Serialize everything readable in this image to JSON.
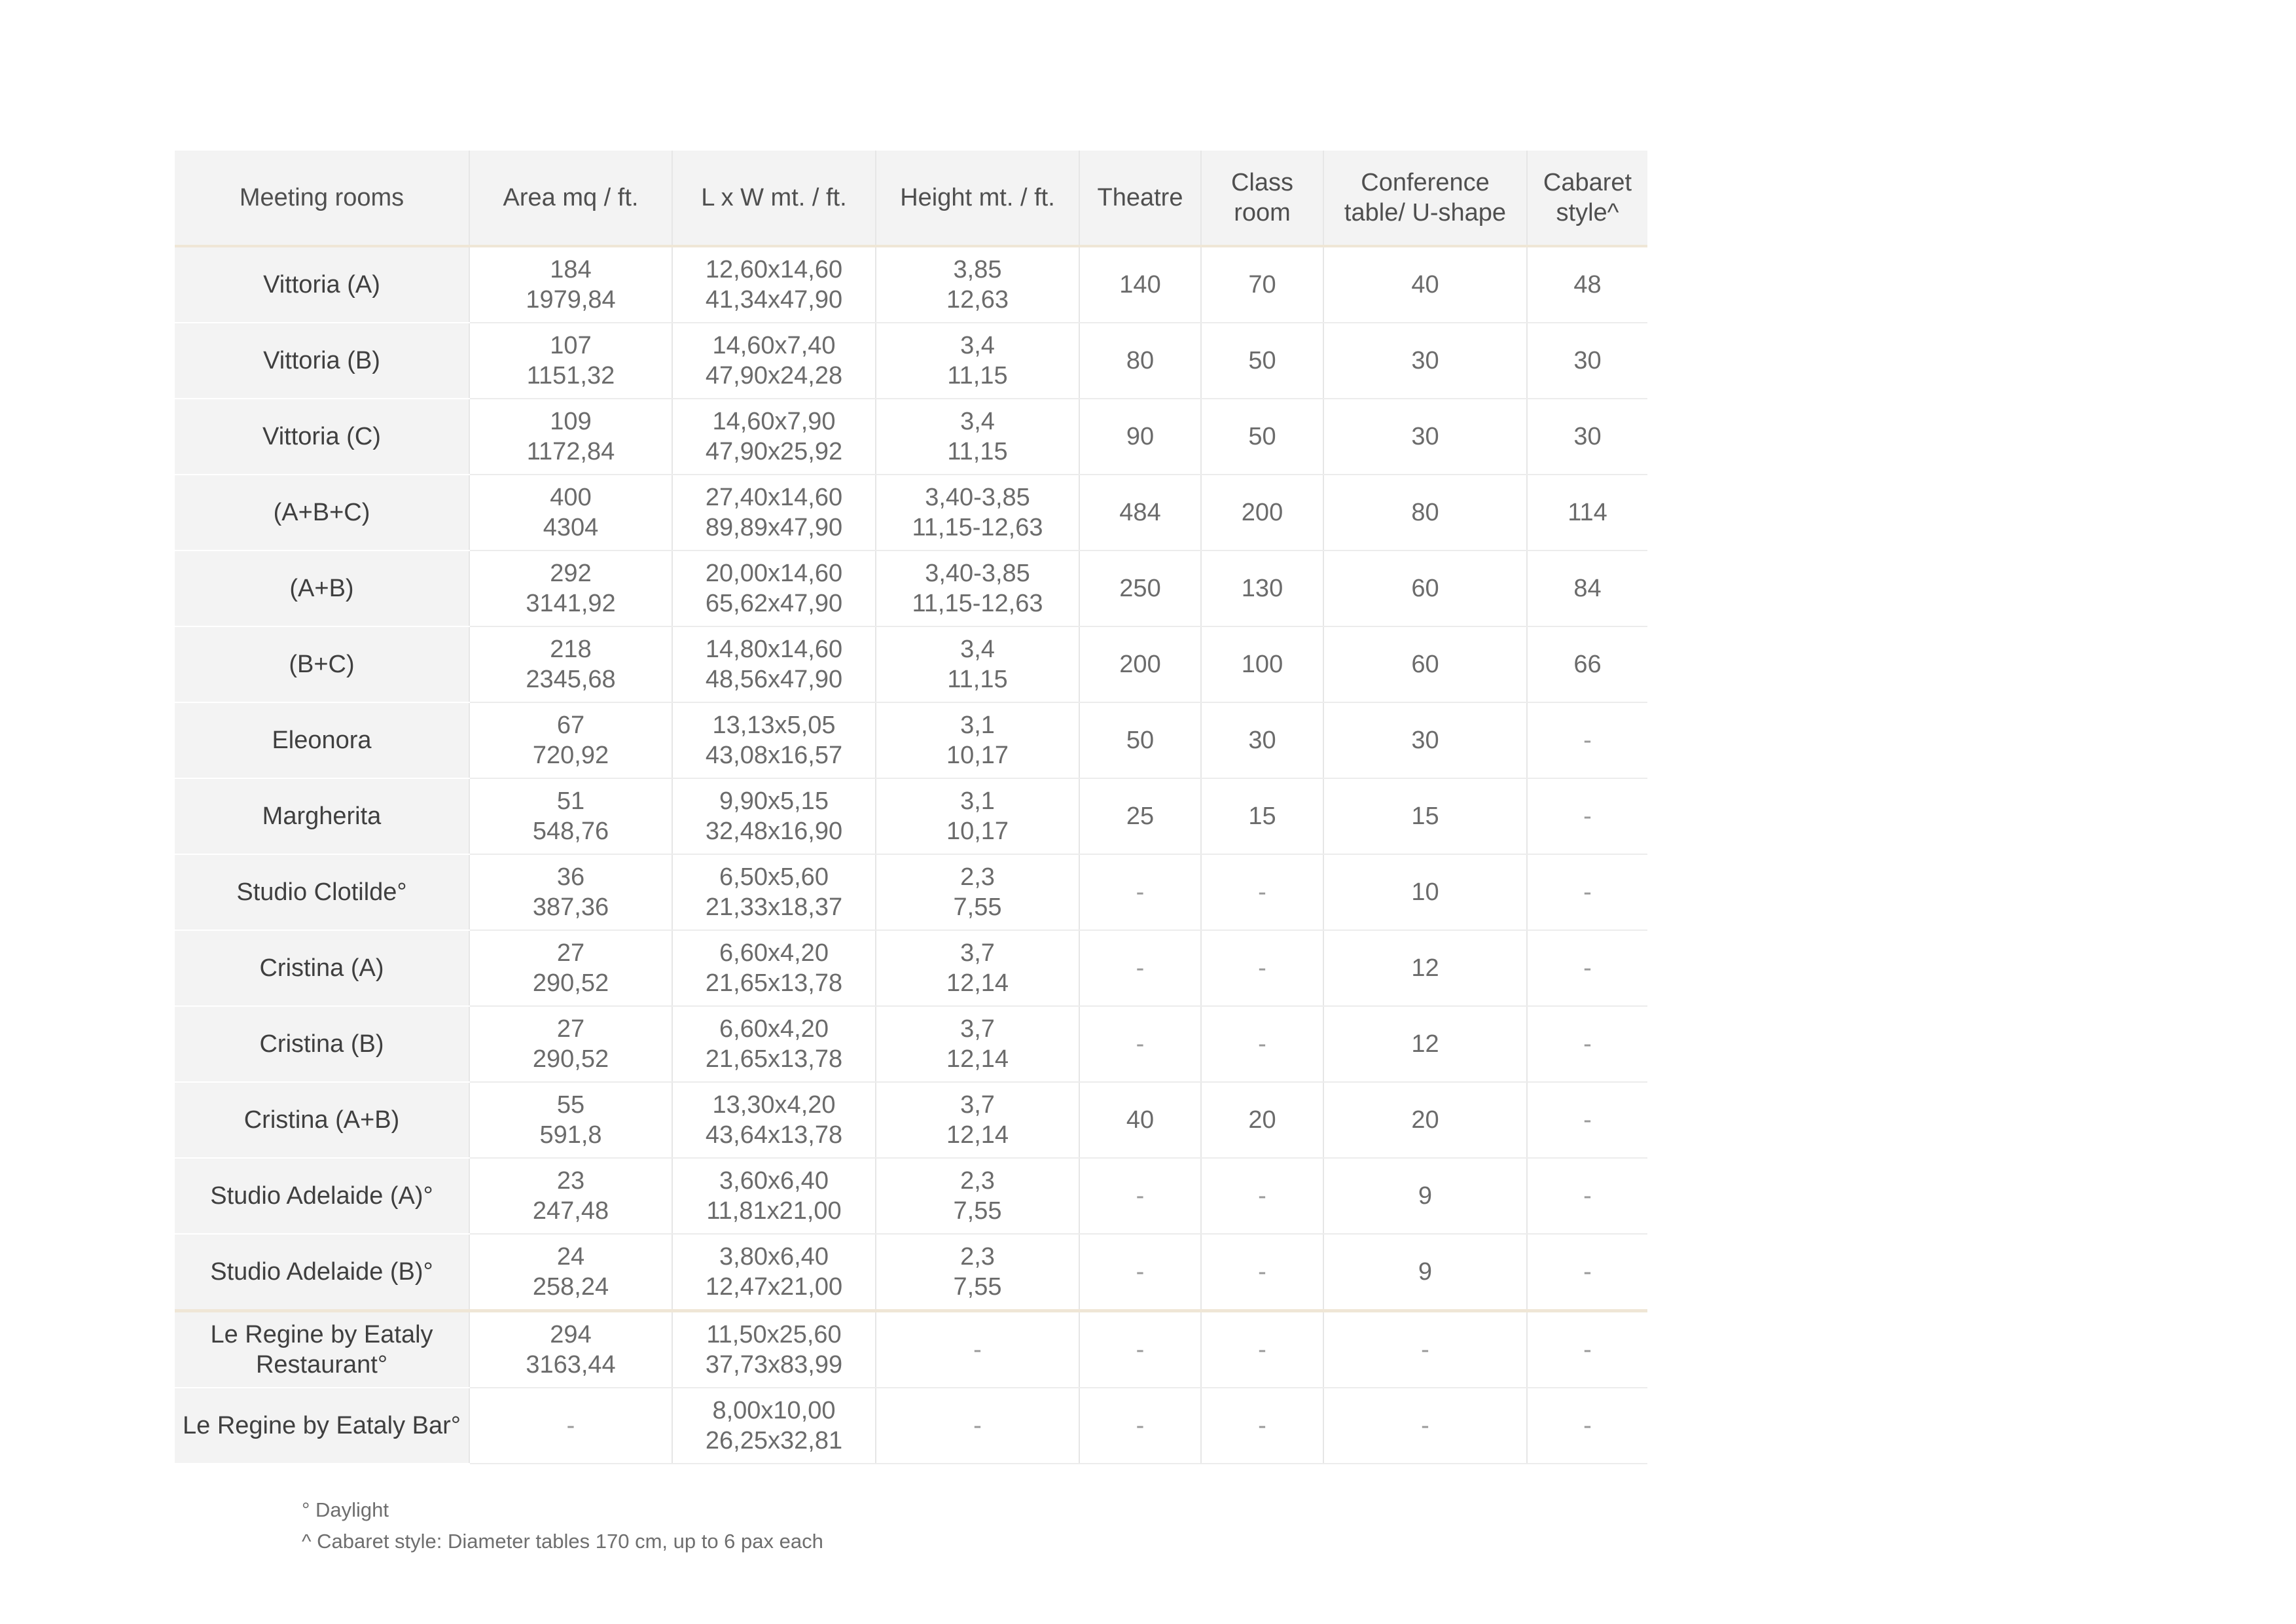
{
  "table": {
    "headers": [
      {
        "lines": [
          "Meeting rooms"
        ]
      },
      {
        "lines": [
          "Area mq / ft."
        ]
      },
      {
        "lines": [
          "L x W mt. / ft."
        ]
      },
      {
        "lines": [
          "Height mt. / ft."
        ]
      },
      {
        "lines": [
          "Theatre"
        ]
      },
      {
        "lines": [
          "Class",
          "room"
        ]
      },
      {
        "lines": [
          "Conference",
          "table/ U-shape"
        ]
      },
      {
        "lines": [
          "Cabaret",
          "style^"
        ]
      }
    ],
    "rows": [
      {
        "name": [
          "Vittoria (A)"
        ],
        "area": [
          "184",
          "1979,84"
        ],
        "lw": [
          "12,60x14,60",
          "41,34x47,90"
        ],
        "height": [
          "3,85",
          "12,63"
        ],
        "theatre": "140",
        "classroom": "70",
        "conference": "40",
        "cabaret": "48"
      },
      {
        "name": [
          "Vittoria (B)"
        ],
        "area": [
          "107",
          "1151,32"
        ],
        "lw": [
          "14,60x7,40",
          "47,90x24,28"
        ],
        "height": [
          "3,4",
          "11,15"
        ],
        "theatre": "80",
        "classroom": "50",
        "conference": "30",
        "cabaret": "30"
      },
      {
        "name": [
          "Vittoria (C)"
        ],
        "area": [
          "109",
          "1172,84"
        ],
        "lw": [
          "14,60x7,90",
          "47,90x25,92"
        ],
        "height": [
          "3,4",
          "11,15"
        ],
        "theatre": "90",
        "classroom": "50",
        "conference": "30",
        "cabaret": "30"
      },
      {
        "name": [
          "(A+B+C)"
        ],
        "area": [
          "400",
          "4304"
        ],
        "lw": [
          "27,40x14,60",
          "89,89x47,90"
        ],
        "height": [
          "3,40-3,85",
          "11,15-12,63"
        ],
        "theatre": "484",
        "classroom": "200",
        "conference": "80",
        "cabaret": "114"
      },
      {
        "name": [
          "(A+B)"
        ],
        "area": [
          "292",
          "3141,92"
        ],
        "lw": [
          "20,00x14,60",
          "65,62x47,90"
        ],
        "height": [
          "3,40-3,85",
          "11,15-12,63"
        ],
        "theatre": "250",
        "classroom": "130",
        "conference": "60",
        "cabaret": "84"
      },
      {
        "name": [
          "(B+C)"
        ],
        "area": [
          "218",
          "2345,68"
        ],
        "lw": [
          "14,80x14,60",
          "48,56x47,90"
        ],
        "height": [
          "3,4",
          "11,15"
        ],
        "theatre": "200",
        "classroom": "100",
        "conference": "60",
        "cabaret": "66"
      },
      {
        "name": [
          "Eleonora"
        ],
        "area": [
          "67",
          "720,92"
        ],
        "lw": [
          "13,13x5,05",
          "43,08x16,57"
        ],
        "height": [
          "3,1",
          "10,17"
        ],
        "theatre": "50",
        "classroom": "30",
        "conference": "30",
        "cabaret": "-"
      },
      {
        "name": [
          "Margherita"
        ],
        "area": [
          "51",
          "548,76"
        ],
        "lw": [
          "9,90x5,15",
          "32,48x16,90"
        ],
        "height": [
          "3,1",
          "10,17"
        ],
        "theatre": "25",
        "classroom": "15",
        "conference": "15",
        "cabaret": "-"
      },
      {
        "name": [
          "Studio Clotilde°"
        ],
        "area": [
          "36",
          "387,36"
        ],
        "lw": [
          "6,50x5,60",
          "21,33x18,37"
        ],
        "height": [
          "2,3",
          "7,55"
        ],
        "theatre": "-",
        "classroom": "-",
        "conference": "10",
        "cabaret": "-"
      },
      {
        "name": [
          "Cristina (A)"
        ],
        "area": [
          "27",
          "290,52"
        ],
        "lw": [
          "6,60x4,20",
          "21,65x13,78"
        ],
        "height": [
          "3,7",
          "12,14"
        ],
        "theatre": "-",
        "classroom": "-",
        "conference": "12",
        "cabaret": "-"
      },
      {
        "name": [
          "Cristina (B)"
        ],
        "area": [
          "27",
          "290,52"
        ],
        "lw": [
          "6,60x4,20",
          "21,65x13,78"
        ],
        "height": [
          "3,7",
          "12,14"
        ],
        "theatre": "-",
        "classroom": "-",
        "conference": "12",
        "cabaret": "-"
      },
      {
        "name": [
          "Cristina (A+B)"
        ],
        "area": [
          "55",
          "591,8"
        ],
        "lw": [
          "13,30x4,20",
          "43,64x13,78"
        ],
        "height": [
          "3,7",
          "12,14"
        ],
        "theatre": "40",
        "classroom": "20",
        "conference": "20",
        "cabaret": "-"
      },
      {
        "name": [
          "Studio Adelaide (A)°"
        ],
        "area": [
          "23",
          "247,48"
        ],
        "lw": [
          "3,60x6,40",
          "11,81x21,00"
        ],
        "height": [
          "2,3",
          "7,55"
        ],
        "theatre": "-",
        "classroom": "-",
        "conference": "9",
        "cabaret": "-"
      },
      {
        "name": [
          "Studio Adelaide (B)°"
        ],
        "area": [
          "24",
          "258,24"
        ],
        "lw": [
          "3,80x6,40",
          "12,47x21,00"
        ],
        "height": [
          "2,3",
          "7,55"
        ],
        "theatre": "-",
        "classroom": "-",
        "conference": "9",
        "cabaret": "-"
      },
      {
        "name": [
          "Le Regine by Eataly",
          "Restaurant°"
        ],
        "area": [
          "294",
          "3163,44"
        ],
        "lw": [
          "11,50x25,60",
          "37,73x83,99"
        ],
        "height": [
          "-"
        ],
        "theatre": "-",
        "classroom": "-",
        "conference": "-",
        "cabaret": "-"
      },
      {
        "name": [
          "Le Regine by Eataly Bar°"
        ],
        "area": [
          "-"
        ],
        "lw": [
          "8,00x10,00",
          "26,25x32,81"
        ],
        "height": [
          "-"
        ],
        "theatre": "-",
        "classroom": "-",
        "conference": "-",
        "cabaret": "-"
      }
    ]
  },
  "footnotes": {
    "daylight": "° Daylight",
    "cabaret": "^ Cabaret style: Diameter tables 170 cm, up to 6 pax each"
  }
}
